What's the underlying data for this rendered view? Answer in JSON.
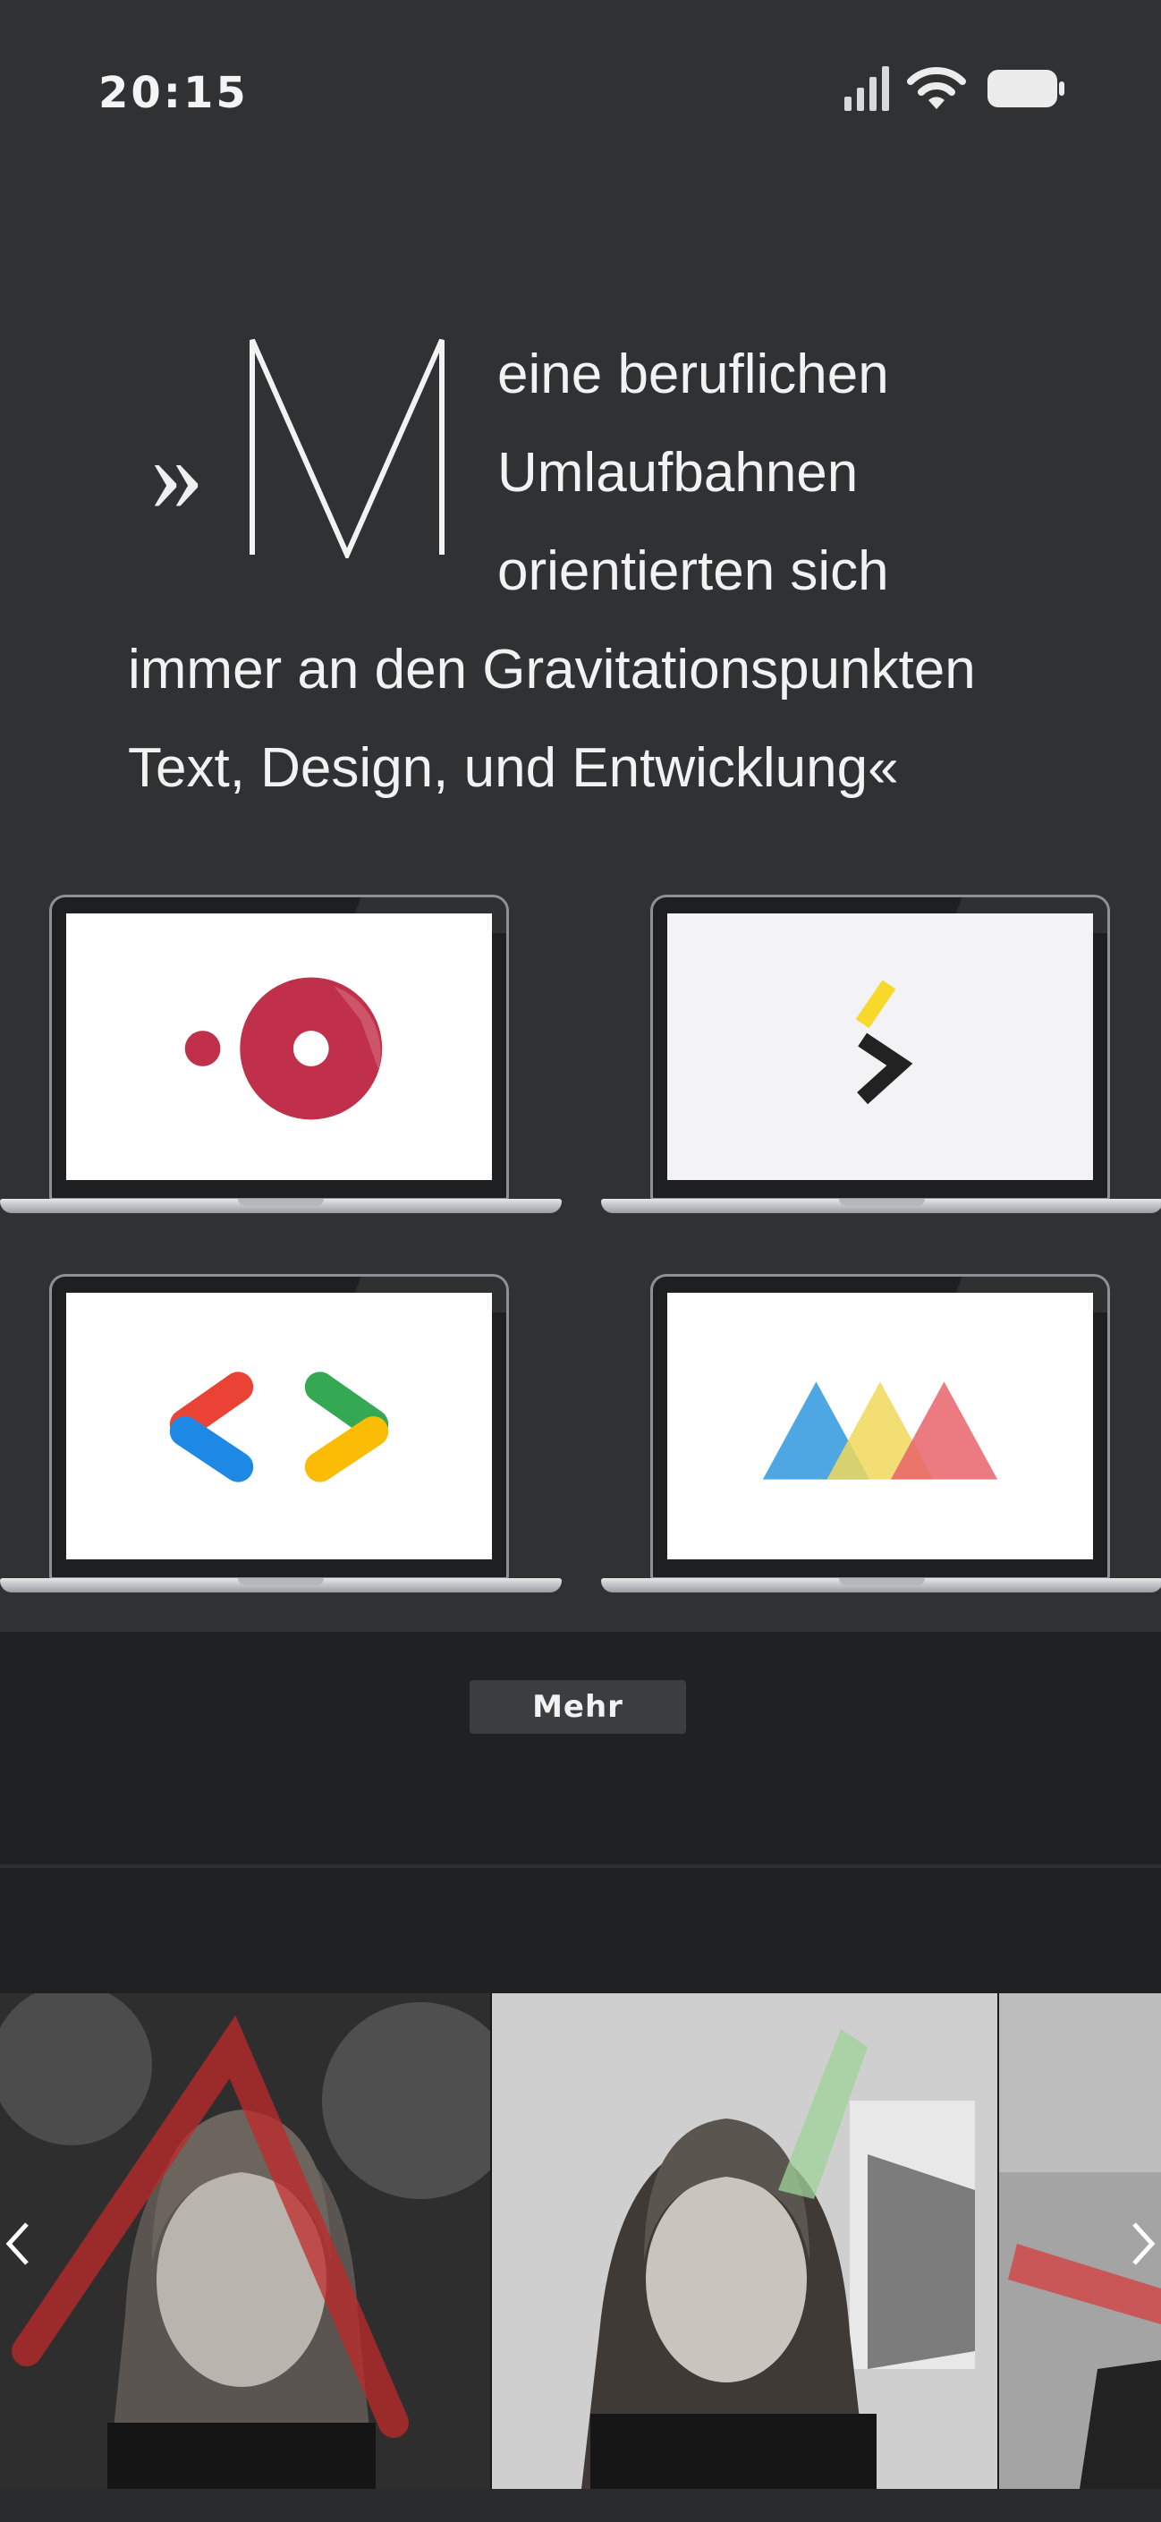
{
  "status_bar": {
    "time": "20:15",
    "icons": [
      "signal-icon",
      "wifi-icon",
      "battery-icon"
    ]
  },
  "quote": {
    "open_mark": "»",
    "drop_cap": "M",
    "lines": [
      "eine beruflichen",
      "Umlaufbahnen",
      "orientierten sich",
      "immer an den Gravitationspunkten",
      "Text, Design, und Entwicklung«"
    ]
  },
  "projects": [
    {
      "icon": "red-circle-logo-icon",
      "colors": [
        "#c1304a"
      ]
    },
    {
      "icon": "yellow-black-chevron-logo-icon",
      "colors": [
        "#f7d92c",
        "#222222"
      ]
    },
    {
      "icon": "code-brackets-logo-icon",
      "colors": [
        "#ea4335",
        "#1e88e5",
        "#34a853",
        "#fbbc05"
      ]
    },
    {
      "icon": "colored-triangles-logo-icon",
      "colors": [
        "#3f9fe0",
        "#f1d85a",
        "#e8646a"
      ]
    }
  ],
  "more_button": {
    "label": "Mehr"
  },
  "carousel": {
    "prev_icon": "chevron-left-icon",
    "next_icon": "chevron-right-icon",
    "photos": [
      "portrait-photo",
      "portrait-photo",
      "portrait-photo"
    ]
  },
  "colors": {
    "background": "#2f3132",
    "section": "#202122",
    "button": "#3b3d3f",
    "text": "#f2f2f2"
  }
}
